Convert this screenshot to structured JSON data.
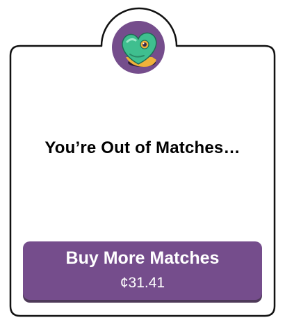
{
  "dialog": {
    "icon": "matches-heart-icon",
    "title": "You’re Out of Matches…"
  },
  "buy_button": {
    "label": "Buy More Matches",
    "price": "¢31.41"
  },
  "colors": {
    "accent": "#754d8c",
    "badge_green": "#3fbf8f",
    "border": "#111111"
  }
}
